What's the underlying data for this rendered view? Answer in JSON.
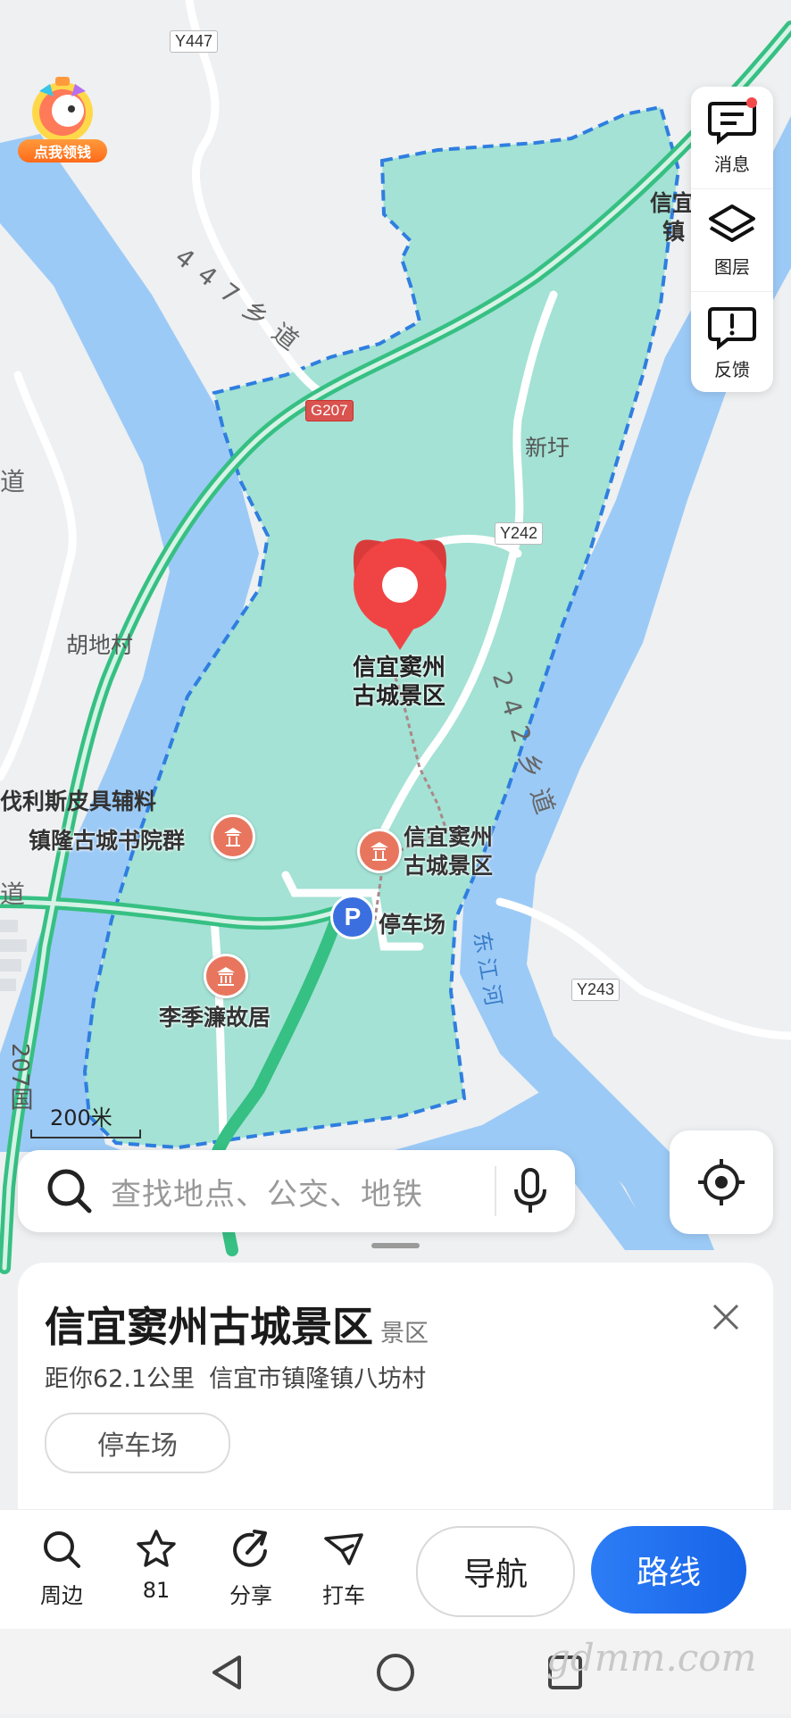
{
  "map": {
    "road_tags": {
      "y447": "Y447",
      "g207": "G207",
      "y242": "Y242",
      "y243": "Y243"
    },
    "road_names": {
      "xiangdao_447": "447乡道",
      "xiangdao_242": "242乡道",
      "dongjiang_river": "东江河",
      "left_edge_road": "道",
      "left_edge_road2": "道",
      "left_vertical_road": "207国"
    },
    "place_labels": {
      "xinxu": "新圩",
      "hudi_village": "胡地村",
      "xinyi_town_1": "信宜",
      "xinyi_town_2": "镇",
      "kelisi_shop": "伐利斯皮具辅料",
      "academy": "镇隆古城书院群",
      "scenic_poi": "信宜窦州古城景区",
      "parking": "停车场",
      "former_residence": "李季濂故居"
    },
    "selected_pin_label": "信宜窦州古城景区",
    "scale": "200米"
  },
  "promo": {
    "badge": "点我领钱"
  },
  "right_panel": {
    "items": [
      {
        "icon": "message-icon",
        "label": "消息",
        "has_dot": true
      },
      {
        "icon": "layers-icon",
        "label": "图层"
      },
      {
        "icon": "feedback-icon",
        "label": "反馈"
      }
    ]
  },
  "search": {
    "placeholder": "查找地点、公交、地铁"
  },
  "place": {
    "name": "信宜窦州古城景区",
    "category": "景区",
    "distance": "距你62.1公里",
    "address": "信宜市镇隆镇八坊村",
    "tag": "停车场"
  },
  "actions": {
    "nearby": "周边",
    "favorites_count": "81",
    "share": "分享",
    "taxi": "打车",
    "navigate": "导航",
    "route": "路线"
  },
  "watermark": "gdmm.com",
  "colors": {
    "water": "#9ccaf6",
    "scenic_area": "#a3e2d4",
    "boundary": "#2f7ee0",
    "highway": "#36c083",
    "pin": "#f04444",
    "route_button": "#1f6ef0"
  }
}
